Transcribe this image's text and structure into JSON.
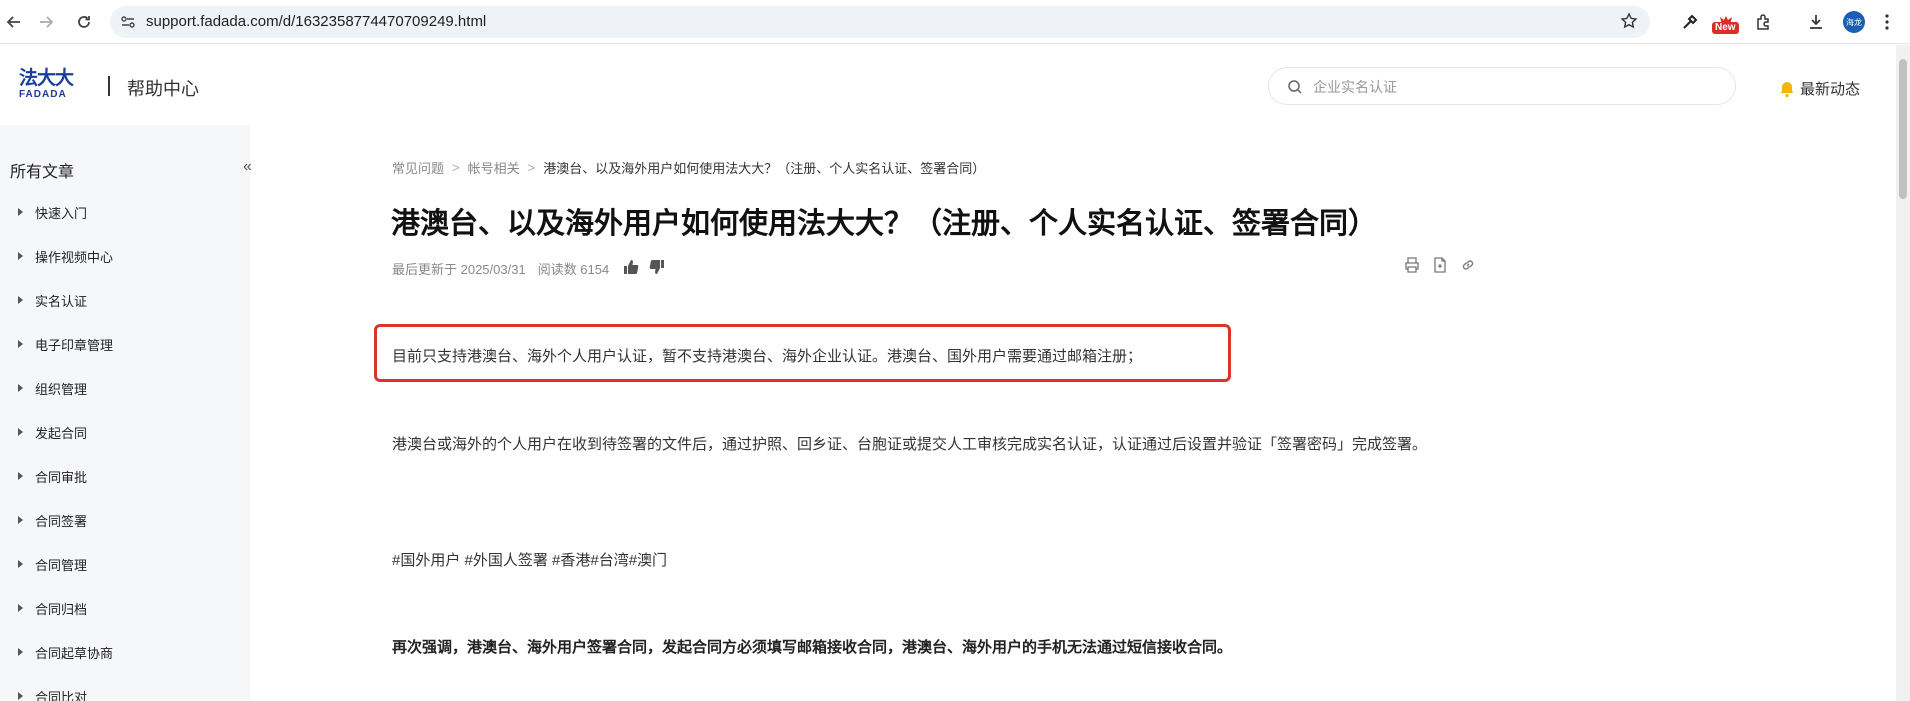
{
  "browser": {
    "url": "support.fadada.com/d/1632358774470709249.html",
    "new_badge": "New",
    "avatar_text": "海龙"
  },
  "header": {
    "logo_cn": "法大大",
    "logo_en": "FADADA",
    "help_center": "帮助中心",
    "search_placeholder": "企业实名认证",
    "news_label": "最新动态"
  },
  "sidebar": {
    "title": "所有文章",
    "collapse": "«",
    "items": [
      {
        "label": "快速入门"
      },
      {
        "label": "操作视频中心"
      },
      {
        "label": "实名认证"
      },
      {
        "label": "电子印章管理"
      },
      {
        "label": "组织管理"
      },
      {
        "label": "发起合同"
      },
      {
        "label": "合同审批"
      },
      {
        "label": "合同签署"
      },
      {
        "label": "合同管理"
      },
      {
        "label": "合同归档"
      },
      {
        "label": "合同起草协商"
      },
      {
        "label": "合同比对"
      }
    ]
  },
  "article": {
    "breadcrumb": [
      "常见问题",
      "帐号相关",
      "港澳台、以及海外用户如何使用法大大？（注册、个人实名认证、签署合同）"
    ],
    "breadcrumb_sep": ">",
    "title": "港澳台、以及海外用户如何使用法大大？（注册、个人实名认证、签署合同）",
    "updated": "最后更新于 2025/03/31",
    "reads": "阅读数 6154",
    "paragraph1": "目前只支持港澳台、海外个人用户认证，暂不支持港澳台、海外企业认证。港澳台、国外用户需要通过邮箱注册；",
    "paragraph2": "港澳台或海外的个人用户在收到待签署的文件后，通过护照、回乡证、台胞证或提交人工审核完成实名认证，认证通过后设置并验证「签署密码」完成签署。",
    "tags": "#国外用户 #外国人签署 #香港#台湾#澳门",
    "emphasis": "再次强调，港澳台、海外用户签署合同，发起合同方必须填写邮箱接收合同，港澳台、海外用户的手机无法通过短信接收合同。"
  },
  "colors": {
    "brand": "#1b3d9c",
    "highlight_border": "#d9362b",
    "sidebar_bg": "#f6f7f9"
  }
}
